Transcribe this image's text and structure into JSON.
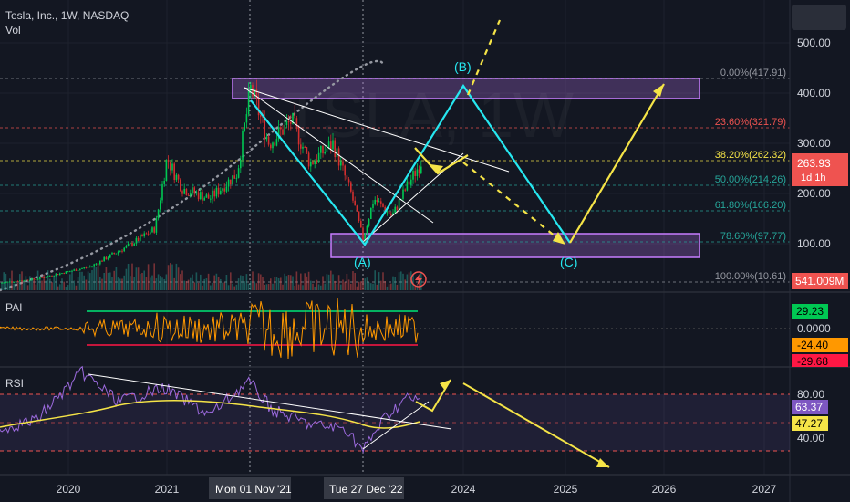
{
  "header": {
    "symbol": "Tesla, Inc., 1W, NASDAQ",
    "volume": "Vol"
  },
  "colors": {
    "bg": "#131722",
    "grid": "#1e222d",
    "text": "#d1d4dc",
    "up": "#26a69a",
    "down": "#ef5350",
    "green_candle": "#00c853",
    "red_candle": "#d32f2f",
    "cyan": "#26e7f0",
    "yellow": "#f5e447",
    "purple": "#c77dff",
    "orange": "#ff9800"
  },
  "chart_data": [
    {
      "type": "candlestick",
      "name_panel": "price",
      "x_ticks": [
        "2020",
        "2021",
        "2024",
        "2025",
        "2026",
        "2027"
      ],
      "x_highlight_labels": [
        "Mon 01 Nov '21",
        "Tue 27 Dec '22"
      ],
      "y_ticks": [
        500,
        400,
        300,
        200,
        100
      ],
      "y_tick_labels": [
        "500.00",
        "400.00",
        "300.00",
        "200.00",
        "100.00"
      ],
      "ylim": [
        0,
        560
      ],
      "scale": "log",
      "last_price": {
        "value": "263.93",
        "sub": "1d 1h"
      },
      "volume_label": "541.009M",
      "fib_levels": [
        {
          "label": "0.00%(417.91)",
          "value": 417.91,
          "color": "#9598a1"
        },
        {
          "label": "23.60%(321.79)",
          "value": 321.79,
          "color": "#ef5350"
        },
        {
          "label": "38.20%(262.32)",
          "value": 262.32,
          "color": "#f5e447"
        },
        {
          "label": "50.00%(214.26)",
          "value": 214.26,
          "color": "#26a69a"
        },
        {
          "label": "61.80%(166.20)",
          "value": 166.2,
          "color": "#26a69a"
        },
        {
          "label": "78.60%(97.77)",
          "value": 97.77,
          "color": "#26a69a"
        },
        {
          "label": "100.00%(10.61)",
          "value": 10.61,
          "color": "#9598a1"
        }
      ],
      "wave_labels": [
        "(A)",
        "(B)",
        "(C)"
      ],
      "series_hint": "weekly candles 2019–2023, peak ~414 Nov 2021, low ~101 Jan 2023, last ~264"
    },
    {
      "type": "line",
      "name_panel": "PAI",
      "title": "PAI",
      "values_labels": [
        "29.23",
        "0.0000",
        "-24.40",
        "-29.68"
      ]
    },
    {
      "type": "line",
      "name_panel": "RSI",
      "title": "RSI",
      "y_ticks_labels": [
        "80.00",
        "40.00"
      ],
      "values_labels": [
        "63.37",
        "47.27"
      ]
    }
  ]
}
